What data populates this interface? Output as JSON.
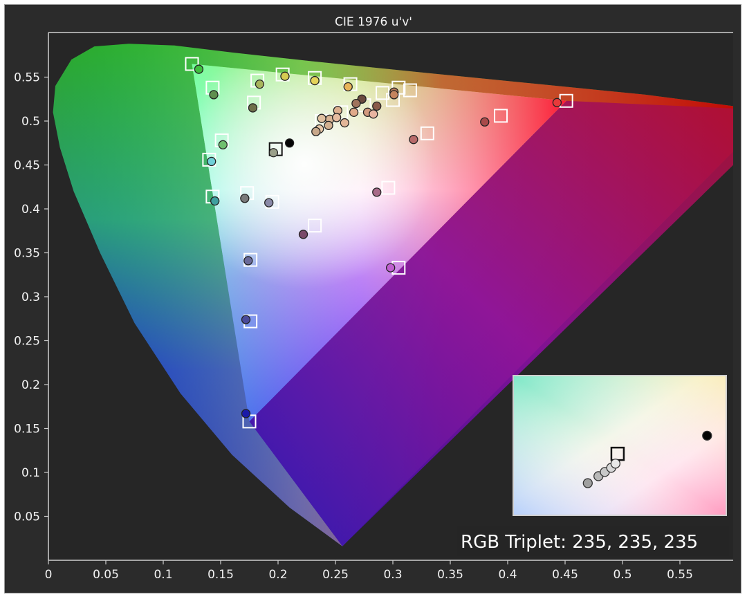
{
  "chart_data": {
    "type": "scatter",
    "title": "CIE 1976 u'v'",
    "xlabel": "",
    "ylabel": "",
    "xlim": [
      0,
      0.6
    ],
    "ylim": [
      0,
      0.6
    ],
    "x_ticks": [
      "0",
      "0.05",
      "0.1",
      "0.15",
      "0.2",
      "0.25",
      "0.3",
      "0.35",
      "0.4",
      "0.45",
      "0.5",
      "0.55"
    ],
    "y_ticks": [
      "0.05",
      "0.1",
      "0.15",
      "0.2",
      "0.25",
      "0.3",
      "0.35",
      "0.4",
      "0.45",
      "0.5",
      "0.55"
    ],
    "gamut_triangle": [
      [
        0.125,
        0.565
      ],
      [
        0.451,
        0.523
      ],
      [
        0.175,
        0.158
      ]
    ],
    "white_point": [
      0.198,
      0.468
    ],
    "targets": [
      [
        0.125,
        0.565
      ],
      [
        0.143,
        0.538
      ],
      [
        0.182,
        0.546
      ],
      [
        0.204,
        0.553
      ],
      [
        0.232,
        0.549
      ],
      [
        0.263,
        0.542
      ],
      [
        0.291,
        0.532
      ],
      [
        0.305,
        0.538
      ],
      [
        0.315,
        0.535
      ],
      [
        0.3,
        0.524
      ],
      [
        0.275,
        0.518
      ],
      [
        0.255,
        0.51
      ],
      [
        0.238,
        0.5
      ],
      [
        0.179,
        0.521
      ],
      [
        0.151,
        0.478
      ],
      [
        0.14,
        0.456
      ],
      [
        0.143,
        0.414
      ],
      [
        0.173,
        0.418
      ],
      [
        0.195,
        0.408
      ],
      [
        0.232,
        0.381
      ],
      [
        0.296,
        0.424
      ],
      [
        0.33,
        0.486
      ],
      [
        0.394,
        0.506
      ],
      [
        0.451,
        0.523
      ],
      [
        0.176,
        0.342
      ],
      [
        0.176,
        0.272
      ],
      [
        0.175,
        0.158
      ],
      [
        0.305,
        0.333
      ],
      [
        0.198,
        0.468
      ]
    ],
    "measured": [
      {
        "u": 0.131,
        "v": 0.559,
        "color": "#3fbf3f"
      },
      {
        "u": 0.144,
        "v": 0.53,
        "color": "#5f8f4f"
      },
      {
        "u": 0.184,
        "v": 0.542,
        "color": "#a8b45c"
      },
      {
        "u": 0.206,
        "v": 0.551,
        "color": "#d6cc52"
      },
      {
        "u": 0.232,
        "v": 0.546,
        "color": "#e4d25a"
      },
      {
        "u": 0.261,
        "v": 0.539,
        "color": "#e8b45a"
      },
      {
        "u": 0.301,
        "v": 0.533,
        "color": "#b57a5a"
      },
      {
        "u": 0.301,
        "v": 0.53,
        "color": "#c4845e"
      },
      {
        "u": 0.286,
        "v": 0.517,
        "color": "#8a5a4a"
      },
      {
        "u": 0.273,
        "v": 0.525,
        "color": "#6a4a3e"
      },
      {
        "u": 0.268,
        "v": 0.52,
        "color": "#a0745c"
      },
      {
        "u": 0.278,
        "v": 0.51,
        "color": "#d29a7e"
      },
      {
        "u": 0.266,
        "v": 0.51,
        "color": "#e0aa8a"
      },
      {
        "u": 0.252,
        "v": 0.512,
        "color": "#dcae8e"
      },
      {
        "u": 0.245,
        "v": 0.502,
        "color": "#d8b494"
      },
      {
        "u": 0.251,
        "v": 0.504,
        "color": "#e6bca0"
      },
      {
        "u": 0.258,
        "v": 0.498,
        "color": "#e2b698"
      },
      {
        "u": 0.238,
        "v": 0.503,
        "color": "#e0c0a0"
      },
      {
        "u": 0.244,
        "v": 0.495,
        "color": "#d2b090"
      },
      {
        "u": 0.236,
        "v": 0.491,
        "color": "#e8c8a8"
      },
      {
        "u": 0.233,
        "v": 0.488,
        "color": "#c8a88a"
      },
      {
        "u": 0.283,
        "v": 0.508,
        "color": "#e8b4a0"
      },
      {
        "u": 0.178,
        "v": 0.515,
        "color": "#6f6f4a"
      },
      {
        "u": 0.152,
        "v": 0.473,
        "color": "#6fbf6f"
      },
      {
        "u": 0.142,
        "v": 0.454,
        "color": "#6fd0d8"
      },
      {
        "u": 0.145,
        "v": 0.409,
        "color": "#3f9f9f"
      },
      {
        "u": 0.171,
        "v": 0.412,
        "color": "#7a7a7a"
      },
      {
        "u": 0.192,
        "v": 0.407,
        "color": "#8a8aa8"
      },
      {
        "u": 0.222,
        "v": 0.371,
        "color": "#7a4a6a"
      },
      {
        "u": 0.286,
        "v": 0.419,
        "color": "#a86a88"
      },
      {
        "u": 0.318,
        "v": 0.479,
        "color": "#b86a6a"
      },
      {
        "u": 0.38,
        "v": 0.499,
        "color": "#a84a4a"
      },
      {
        "u": 0.443,
        "v": 0.521,
        "color": "#e83a3a"
      },
      {
        "u": 0.174,
        "v": 0.341,
        "color": "#6a6a9a"
      },
      {
        "u": 0.172,
        "v": 0.274,
        "color": "#4a4a9a"
      },
      {
        "u": 0.172,
        "v": 0.167,
        "color": "#1a1aa8"
      },
      {
        "u": 0.298,
        "v": 0.333,
        "color": "#c060d0"
      },
      {
        "u": 0.196,
        "v": 0.464,
        "color": "#9aa08a"
      },
      {
        "u": 0.21,
        "v": 0.475,
        "color": "#050505"
      }
    ],
    "inset": {
      "label": "RGB Triplet: 235, 235, 235",
      "target_label": "",
      "points": [
        {
          "rx": 0.35,
          "ry": 0.77,
          "color": "#a0a0a0"
        },
        {
          "rx": 0.4,
          "ry": 0.72,
          "color": "#b8b8b8"
        },
        {
          "rx": 0.43,
          "ry": 0.69,
          "color": "#c8c8c8"
        },
        {
          "rx": 0.46,
          "ry": 0.66,
          "color": "#d8d8d8"
        },
        {
          "rx": 0.48,
          "ry": 0.63,
          "color": "#e8e8e8"
        },
        {
          "rx": 0.91,
          "ry": 0.43,
          "color": "#050505"
        }
      ],
      "target": [
        0.49,
        0.56
      ]
    }
  }
}
